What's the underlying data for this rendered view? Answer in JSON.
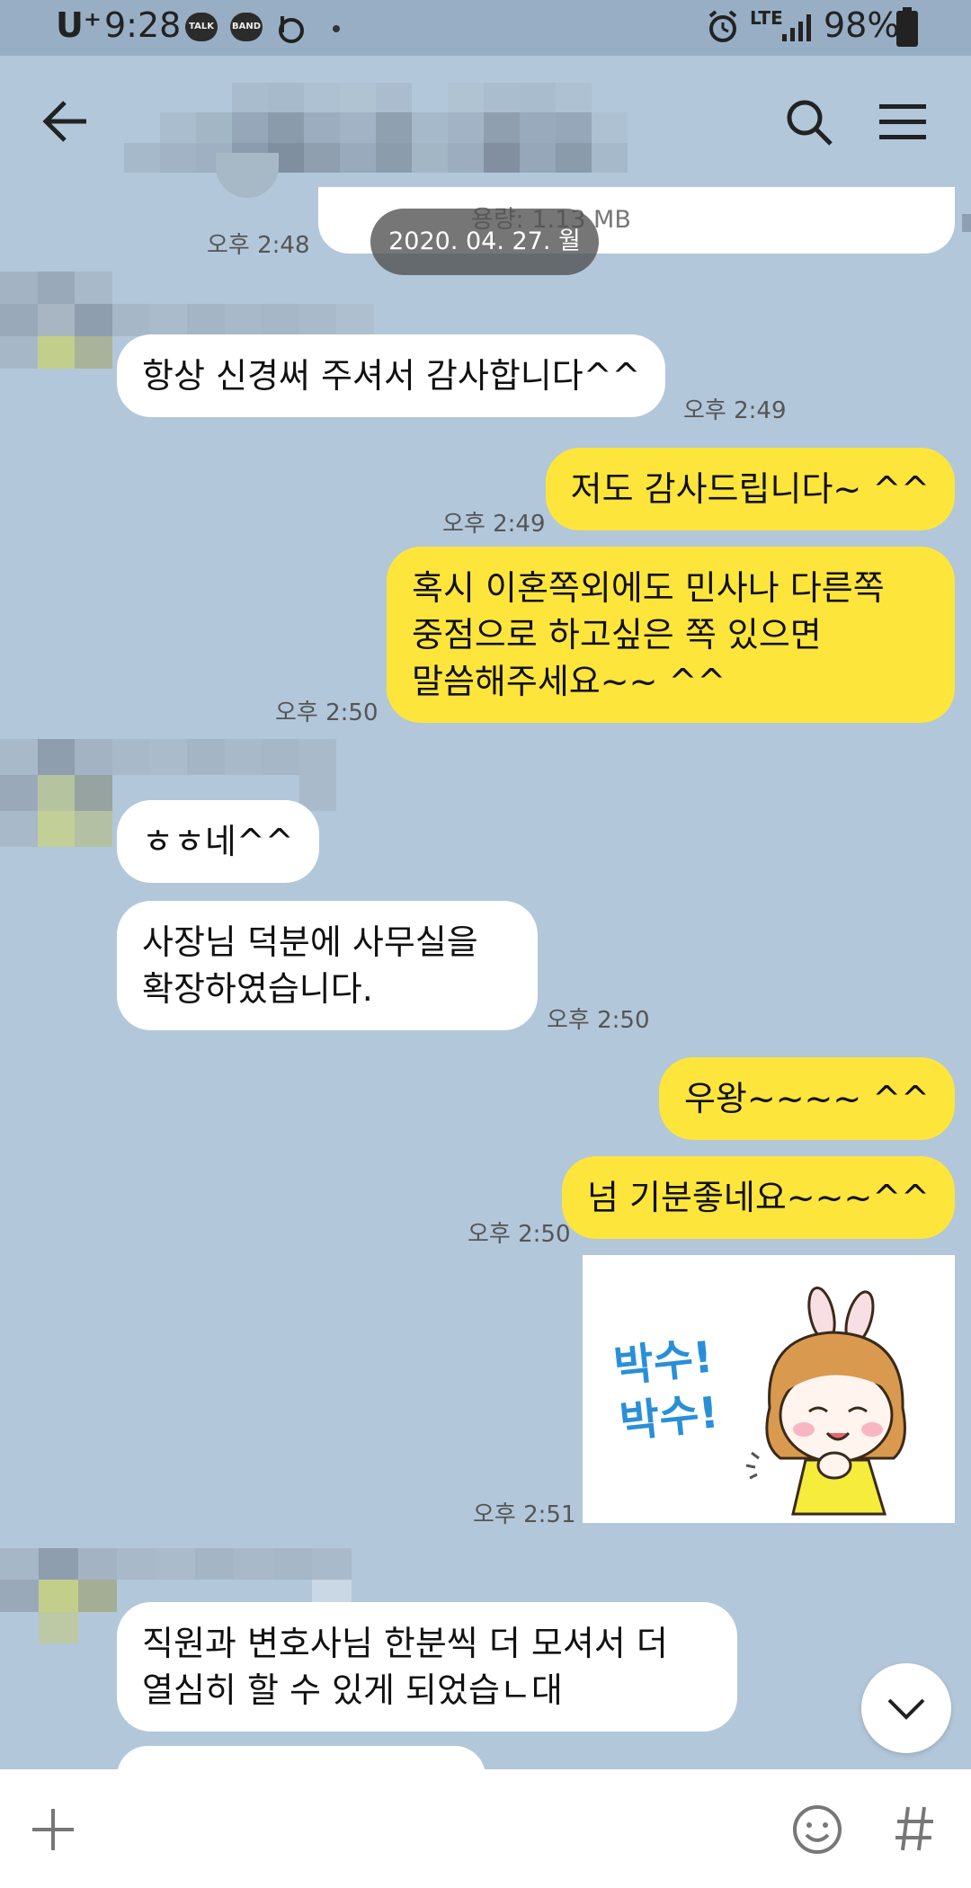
{
  "status_bar": {
    "carrier": "U⁺",
    "time": "9:28",
    "apps": [
      "TALK",
      "BAND"
    ],
    "network": "LTE",
    "battery": "98%"
  },
  "header": {
    "back_icon": "arrow-left-icon",
    "search_icon": "search-icon",
    "menu_icon": "hamburger-menu-icon"
  },
  "chat": {
    "file_size_text": "용량: 1.13 MB",
    "date_divider": "2020. 04. 27. 월",
    "messages": [
      {
        "side": "in",
        "text": "",
        "time": "오후 2:48"
      },
      {
        "side": "in",
        "text": "항상 신경써 주셔서 감사합니다^^",
        "time": "오후 2:49"
      },
      {
        "side": "out",
        "text": "저도 감사드립니다~ ^^",
        "time": "오후 2:49"
      },
      {
        "side": "out",
        "text": "혹시 이혼쪽외에도 민사나 다른쪽\n중점으로 하고싶은 쪽 있으면\n말씀해주세요~~ ^^",
        "time": "오후 2:50"
      },
      {
        "side": "in",
        "text": "ㅎㅎ네^^",
        "time": ""
      },
      {
        "side": "in",
        "text": "사장님 덕분에 사무실을\n확장하였습니다.",
        "time": "오후 2:50"
      },
      {
        "side": "out",
        "text": "우왕~~~~ ^^",
        "time": ""
      },
      {
        "side": "out",
        "text": "넘 기분좋네요~~~^^",
        "time": "오후 2:50"
      },
      {
        "side": "out",
        "sticker_text": "박수!\n박수!",
        "time": "오후 2:51"
      },
      {
        "side": "in",
        "text": "직원과 변호사님 한분씩 더 모셔서 더\n열심히 할 수 있게 되었습ㄴ대",
        "time": ""
      }
    ]
  },
  "input_bar": {
    "plus_icon": "plus-icon",
    "emoji_icon": "emoji-icon",
    "hash_icon": "hash-icon"
  },
  "scroll_down_icon": "chevron-down-icon",
  "colors": {
    "background": "#b2c7da",
    "outgoing_bubble": "#fee53b",
    "incoming_bubble": "#ffffff"
  }
}
